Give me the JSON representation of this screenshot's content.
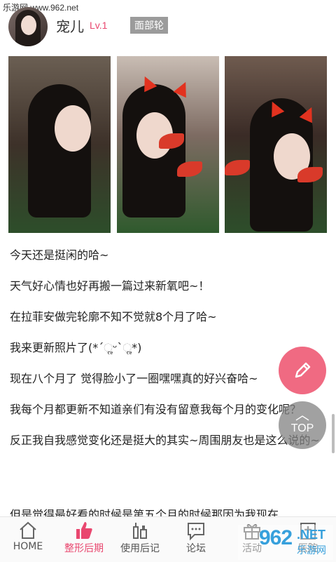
{
  "watermark": "乐游网 www.962.net",
  "header": {
    "username": "宠儿",
    "level": "Lv.1",
    "tag": "面部轮"
  },
  "post": {
    "paragraphs": [
      "今天还是挺闲的哈~",
      "天气好心情也好再搬一篇过来新氧吧~！",
      "在拉菲安做完轮廓不知不觉就8个月了哈~",
      "我来更新照片了(*ˊૢᵕˋૢ*)",
      "现在八个月了 觉得脸小了一圈嘿嘿真的好兴奋哈~",
      "我每个月都更新不知道亲们有没有留意我每个月的变化呢？",
      "反正我自我感觉变化还是挺大的其实~周围朋友也是这么说的~",
      "但是觉得最好看的时候是第五个月的时候那因为我现在"
    ]
  },
  "fab": {
    "top_label": "TOP"
  },
  "tabs": [
    {
      "label": "HOME",
      "icon": "home-icon"
    },
    {
      "label": "整形后期",
      "icon": "thumb-up-icon",
      "active": true
    },
    {
      "label": "使用后记",
      "icon": "cosmetics-icon"
    },
    {
      "label": "论坛",
      "icon": "chat-icon"
    },
    {
      "label": "活动",
      "icon": "gift-icon"
    },
    {
      "label": "医院",
      "icon": "hospital-icon"
    }
  ],
  "logo_watermark": {
    "big": "962",
    "net": ".NET",
    "cn": "乐游网"
  },
  "colors": {
    "accent": "#e9476f",
    "fab_edit": "#f06a82",
    "brand_watermark": "#37a0dc"
  }
}
